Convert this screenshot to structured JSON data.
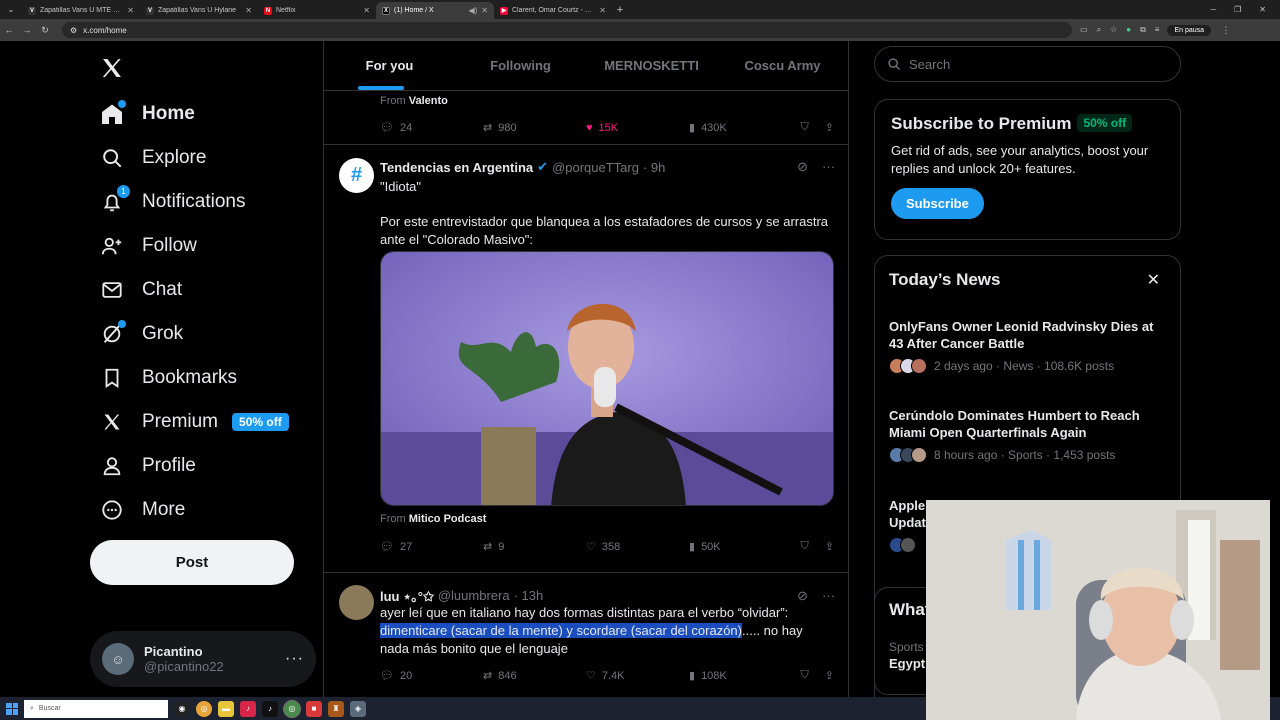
{
  "browser": {
    "tabs": [
      {
        "title": "Zapatillas Vans U MTE Ultrarange",
        "color": "#ffffff",
        "glyph": "V"
      },
      {
        "title": "Zapatillas Vans U Hylane",
        "color": "#ffffff",
        "glyph": "V"
      },
      {
        "title": "Netflix",
        "color": "#e50914",
        "glyph": "N"
      },
      {
        "title": "(1) Home / X",
        "color": "#000000",
        "glyph": "X"
      },
      {
        "title": "Clarent, Omar Courtz - Scat Pack",
        "color": "#ff0033",
        "glyph": "▶"
      }
    ],
    "url": "x.com/home",
    "paused_label": "En pausa"
  },
  "sidebar": {
    "items": [
      {
        "label": "Home",
        "icon": "home-icon"
      },
      {
        "label": "Explore",
        "icon": "search-icon"
      },
      {
        "label": "Notifications",
        "icon": "bell-icon",
        "badge": "1"
      },
      {
        "label": "Follow",
        "icon": "add-person-icon"
      },
      {
        "label": "Chat",
        "icon": "mail-icon"
      },
      {
        "label": "Grok",
        "icon": "grok-icon"
      },
      {
        "label": "Bookmarks",
        "icon": "bookmark-icon"
      },
      {
        "label": "Premium",
        "icon": "x-logo-icon",
        "pill": "50% off"
      },
      {
        "label": "Profile",
        "icon": "person-icon"
      },
      {
        "label": "More",
        "icon": "more-circle-icon"
      }
    ],
    "post_label": "Post",
    "account": {
      "name": "Picantino",
      "handle": "@picantino22"
    }
  },
  "timeline": {
    "tabs": [
      "For you",
      "Following",
      "MERNOSKETTI",
      "Coscu Army"
    ],
    "prev_tweet": {
      "from_prefix": "From",
      "from_name": "Valento",
      "replies": "24",
      "reposts": "980",
      "likes": "15K",
      "views": "430K"
    },
    "tweet1": {
      "name": "Tendencias en Argentina",
      "handle": "@porqueTTarg",
      "time": "· 9h",
      "line1": "\"Idiota\"",
      "line2": "Por este entrevistador que blanquea a los estafadores de cursos y se arrastra ante el \"Colorado Masivo\":",
      "from_prefix": "From",
      "from_name": "Mitico Podcast",
      "replies": "27",
      "reposts": "9",
      "likes": "358",
      "views": "50K"
    },
    "tweet2": {
      "name": "luu ⋆｡°✩",
      "handle": "@luumbrera",
      "time": "· 13h",
      "text_a": "ayer leí que en italiano hay dos formas distintas para el verbo “olvidar”: ",
      "text_hl": "dimenticare (sacar de la mente) y scordare (sacar del corazón)",
      "text_b": "..... no hay nada más bonito que el lenguaje",
      "replies": "20",
      "reposts": "846",
      "likes": "7.4K",
      "views": "108K"
    }
  },
  "right": {
    "search_placeholder": "Search",
    "premium": {
      "title": "Subscribe to Premium",
      "pill": "50% off",
      "body": "Get rid of ads, see your analytics, boost your replies and unlock 20+ features.",
      "button": "Subscribe"
    },
    "news": {
      "title": "Today’s News",
      "items": [
        {
          "title": "OnlyFans Owner Leonid Radvinsky Dies at 43 After Cancer Battle",
          "meta": "2 days ago · News · 108.6K posts"
        },
        {
          "title": "Cerúndolo Dominates Humbert to Reach Miami Open Quarterfinals Again",
          "meta": "8 hours ago · Sports · 1,453 posts"
        },
        {
          "title": "Apple Releases iOS 26.4 and iPadOS 26.4 Updates",
          "meta": ""
        }
      ]
    },
    "whats": {
      "title": "What’s happening",
      "cat": "Sports",
      "topic": "Egypt"
    }
  },
  "taskbar": {
    "search_placeholder": "Buscar"
  }
}
